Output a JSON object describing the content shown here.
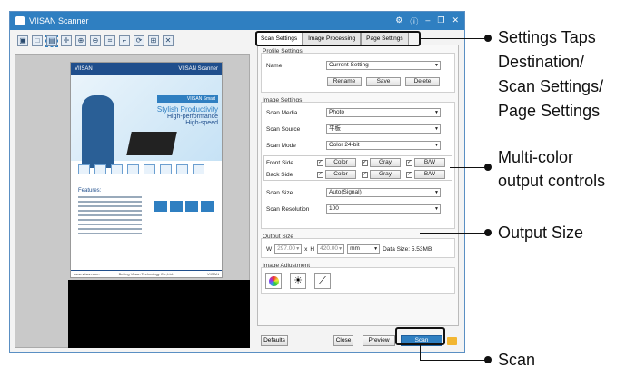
{
  "window": {
    "title": "VIISAN Scanner",
    "controls": [
      "⚙",
      "ⓘ",
      "–",
      "❐",
      "✕"
    ]
  },
  "toolbar_icons": [
    "scanner-icon",
    "page-icon",
    "select-icon",
    "move-icon",
    "zoom-in-icon",
    "zoom-out-icon",
    "fit-icon",
    "crop-icon",
    "rotate-icon",
    "grid-icon",
    "delete-icon"
  ],
  "preview": {
    "brand": "VIISAN",
    "brand_right": "VIISAN Scanner",
    "tag": "VIISAN Smart",
    "slogan1": "Stylish Productivity",
    "slogan2": "High-performance",
    "slogan3": "High-speed",
    "features_title": "Features:",
    "footer_left": "www.viisan.com",
    "footer_mid": "Beijing Viisan Technology Co.,Ltd.",
    "footer_right": "VIISAN"
  },
  "tabs": [
    {
      "label": "Scan Settings",
      "active": true
    },
    {
      "label": "Image Processing",
      "active": false
    },
    {
      "label": "Page Settings",
      "active": false
    }
  ],
  "profile": {
    "title": "Profile Settings",
    "name_label": "Name",
    "name_value": "Current Setting",
    "rename": "Rename",
    "save": "Save",
    "delete": "Delete"
  },
  "image_settings": {
    "title": "Image Settings",
    "scan_media_label": "Scan Media",
    "scan_media": "Photo",
    "scan_source_label": "Scan Source",
    "scan_source": "平板",
    "scan_mode_label": "Scan Mode",
    "scan_mode": "Color 24-bit",
    "front_side": "Front Side",
    "back_side": "Back Side",
    "color": "Color",
    "gray": "Gray",
    "bw": "B/W",
    "scan_size_label": "Scan Size",
    "scan_size": "Auto(Signal)",
    "scan_resolution_label": "Scan Resolution",
    "scan_resolution": "100"
  },
  "output": {
    "title": "Output Size",
    "w_label": "W",
    "w_value": "297.00",
    "x_label": "x",
    "h_label": "H",
    "h_value": "420.00",
    "unit": "mm",
    "data_size": "Data Size: 5.53MB"
  },
  "adjust": {
    "title": "Image Adjustment"
  },
  "buttons": {
    "defaults": "Defaults",
    "close": "Close",
    "preview": "Preview",
    "scan": "Scan"
  },
  "callouts": {
    "settings1": "Settings Taps",
    "settings2": "Destination/",
    "settings3": "Scan Settings/",
    "settings4": "Page Settings",
    "multi1": "Multi-color",
    "multi2": "output controls",
    "output": "Output Size",
    "scan": "Scan"
  },
  "colors": {
    "accent": "#2f7fc1",
    "title_bar": "#2f7fc1",
    "folder": "#f2b632"
  }
}
